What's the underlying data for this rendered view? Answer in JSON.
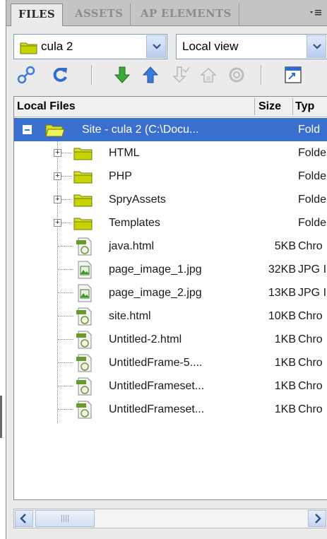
{
  "tabs": [
    {
      "label": "FILES",
      "active": true
    },
    {
      "label": "ASSETS",
      "active": false
    },
    {
      "label": "AP ELEMENTS",
      "active": false
    }
  ],
  "site_select": {
    "value": "cula 2"
  },
  "view_select": {
    "value": "Local view"
  },
  "columns": {
    "name": "Local Files",
    "size": "Size",
    "type": "Typ"
  },
  "root": {
    "name": "Site - cula 2 (C:\\Docu...",
    "type": "Fold"
  },
  "folders": [
    {
      "name": "HTML",
      "type": "Folde"
    },
    {
      "name": "PHP",
      "type": "Folde"
    },
    {
      "name": "SpryAssets",
      "type": "Folde"
    },
    {
      "name": "Templates",
      "type": "Folde"
    }
  ],
  "files": [
    {
      "name": "java.html",
      "size": "5KB",
      "type": "Chro",
      "icon": "html-file-icon"
    },
    {
      "name": "page_image_1.jpg",
      "size": "32KB",
      "type": "JPG I",
      "icon": "image-file-icon"
    },
    {
      "name": "page_image_2.jpg",
      "size": "13KB",
      "type": "JPG I",
      "icon": "image-file-icon"
    },
    {
      "name": "site.html",
      "size": "10KB",
      "type": "Chro",
      "icon": "html-file-icon"
    },
    {
      "name": "Untitled-2.html",
      "size": "1KB",
      "type": "Chro",
      "icon": "html-file-icon"
    },
    {
      "name": "UntitledFrame-5....",
      "size": "1KB",
      "type": "Chro",
      "icon": "html-file-icon"
    },
    {
      "name": "UntitledFrameset...",
      "size": "1KB",
      "type": "Chro",
      "icon": "html-file-icon"
    },
    {
      "name": "UntitledFrameset...",
      "size": "1KB",
      "type": "Chro",
      "icon": "html-file-icon"
    }
  ],
  "colors": {
    "selection": "#3a6fd0",
    "folder": "#d9e021",
    "arrow_green": "#3aa935",
    "arrow_blue": "#3a7ad8"
  }
}
